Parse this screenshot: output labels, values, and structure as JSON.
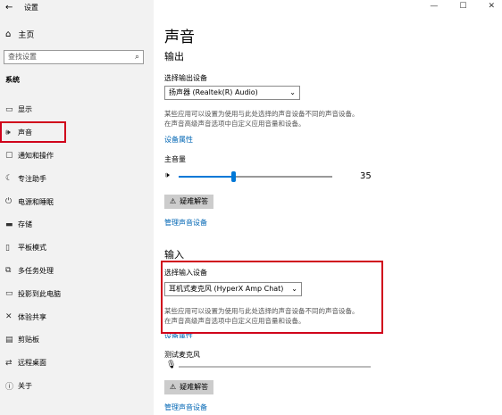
{
  "titlebar": {
    "back_icon": "back-arrow-icon",
    "title": "设置"
  },
  "window_controls": {
    "minimize": "—",
    "maximize": "☐",
    "close": "✕"
  },
  "sidebar": {
    "home_label": "主页",
    "search_placeholder": "查找设置",
    "section_title": "系统",
    "items": [
      {
        "label": "显示",
        "icon": "monitor-icon",
        "glyph": "▭"
      },
      {
        "label": "声音",
        "icon": "speaker-icon",
        "glyph": "🔈"
      },
      {
        "label": "通知和操作",
        "icon": "notification-icon",
        "glyph": "▢"
      },
      {
        "label": "专注助手",
        "icon": "moon-icon",
        "glyph": "☾"
      },
      {
        "label": "电源和睡眠",
        "icon": "power-icon",
        "glyph": "⏻"
      },
      {
        "label": "存储",
        "icon": "storage-icon",
        "glyph": "▬"
      },
      {
        "label": "平板模式",
        "icon": "tablet-icon",
        "glyph": "▯"
      },
      {
        "label": "多任务处理",
        "icon": "multitask-icon",
        "glyph": "⧉"
      },
      {
        "label": "投影到此电脑",
        "icon": "projector-icon",
        "glyph": "▭"
      },
      {
        "label": "体验共享",
        "icon": "share-icon",
        "glyph": "✕"
      },
      {
        "label": "剪贴板",
        "icon": "clipboard-icon",
        "glyph": "▤"
      },
      {
        "label": "远程桌面",
        "icon": "remote-icon",
        "glyph": "⇄"
      },
      {
        "label": "关于",
        "icon": "info-icon",
        "glyph": "ⓘ"
      }
    ]
  },
  "main": {
    "page_title": "声音",
    "output": {
      "heading": "输出",
      "select_label": "选择输出设备",
      "selected_device": "扬声器 (Realtek(R) Audio)",
      "desc_line1": "某些应用可以设置为使用与此处选择的声音设备不同的声音设备。",
      "desc_line2": "在声音高级声音选项中自定义应用音量和设备。",
      "properties_link": "设备属性",
      "master_volume_label": "主音量",
      "volume_value": "35",
      "volume_fraction": 0.35,
      "troubleshoot_label": "疑难解答",
      "manage_link": "管理声音设备"
    },
    "input": {
      "heading": "输入",
      "select_label": "选择输入设备",
      "selected_device": "耳机式麦克风 (HyperX Amp Chat)",
      "desc_line1": "某些应用可以设置为使用与此处选择的声音设备不同的声音设备。",
      "desc_line2": "在声音高级声音选项中自定义应用音量和设备。",
      "properties_link": "设备属性",
      "test_label": "测试麦克风",
      "troubleshoot_label": "疑难解答",
      "manage_link": "管理声音设备"
    }
  }
}
